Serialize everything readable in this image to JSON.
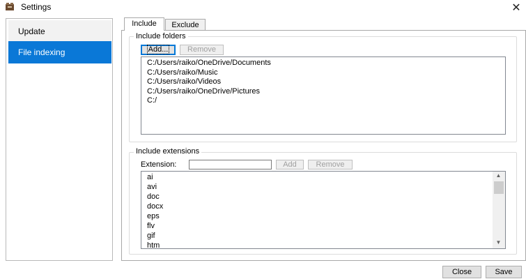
{
  "window": {
    "title": "Settings",
    "icon": "app-icon",
    "close_glyph": "✕"
  },
  "sidebar": {
    "items": [
      {
        "label": "Update",
        "active": false
      },
      {
        "label": "File indexing",
        "active": true
      }
    ]
  },
  "tabs": [
    {
      "label": "Include",
      "active": true
    },
    {
      "label": "Exclude",
      "active": false
    }
  ],
  "include_folders": {
    "group_label": "Include folders",
    "add_button": "Add...",
    "remove_button": "Remove",
    "folders": [
      "C:/Users/raiko/OneDrive/Documents",
      "C:/Users/raiko/Music",
      "C:/Users/raiko/Videos",
      "C:/Users/raiko/OneDrive/Pictures",
      "C:/"
    ]
  },
  "include_extensions": {
    "group_label": "Include extensions",
    "extension_label": "Extension:",
    "extension_value": "",
    "add_button": "Add",
    "remove_button": "Remove",
    "extensions": [
      "ai",
      "avi",
      "doc",
      "docx",
      "eps",
      "flv",
      "gif",
      "htm"
    ]
  },
  "footer": {
    "close_button": "Close",
    "save_button": "Save"
  },
  "colors": {
    "accent": "#0a78d7"
  }
}
